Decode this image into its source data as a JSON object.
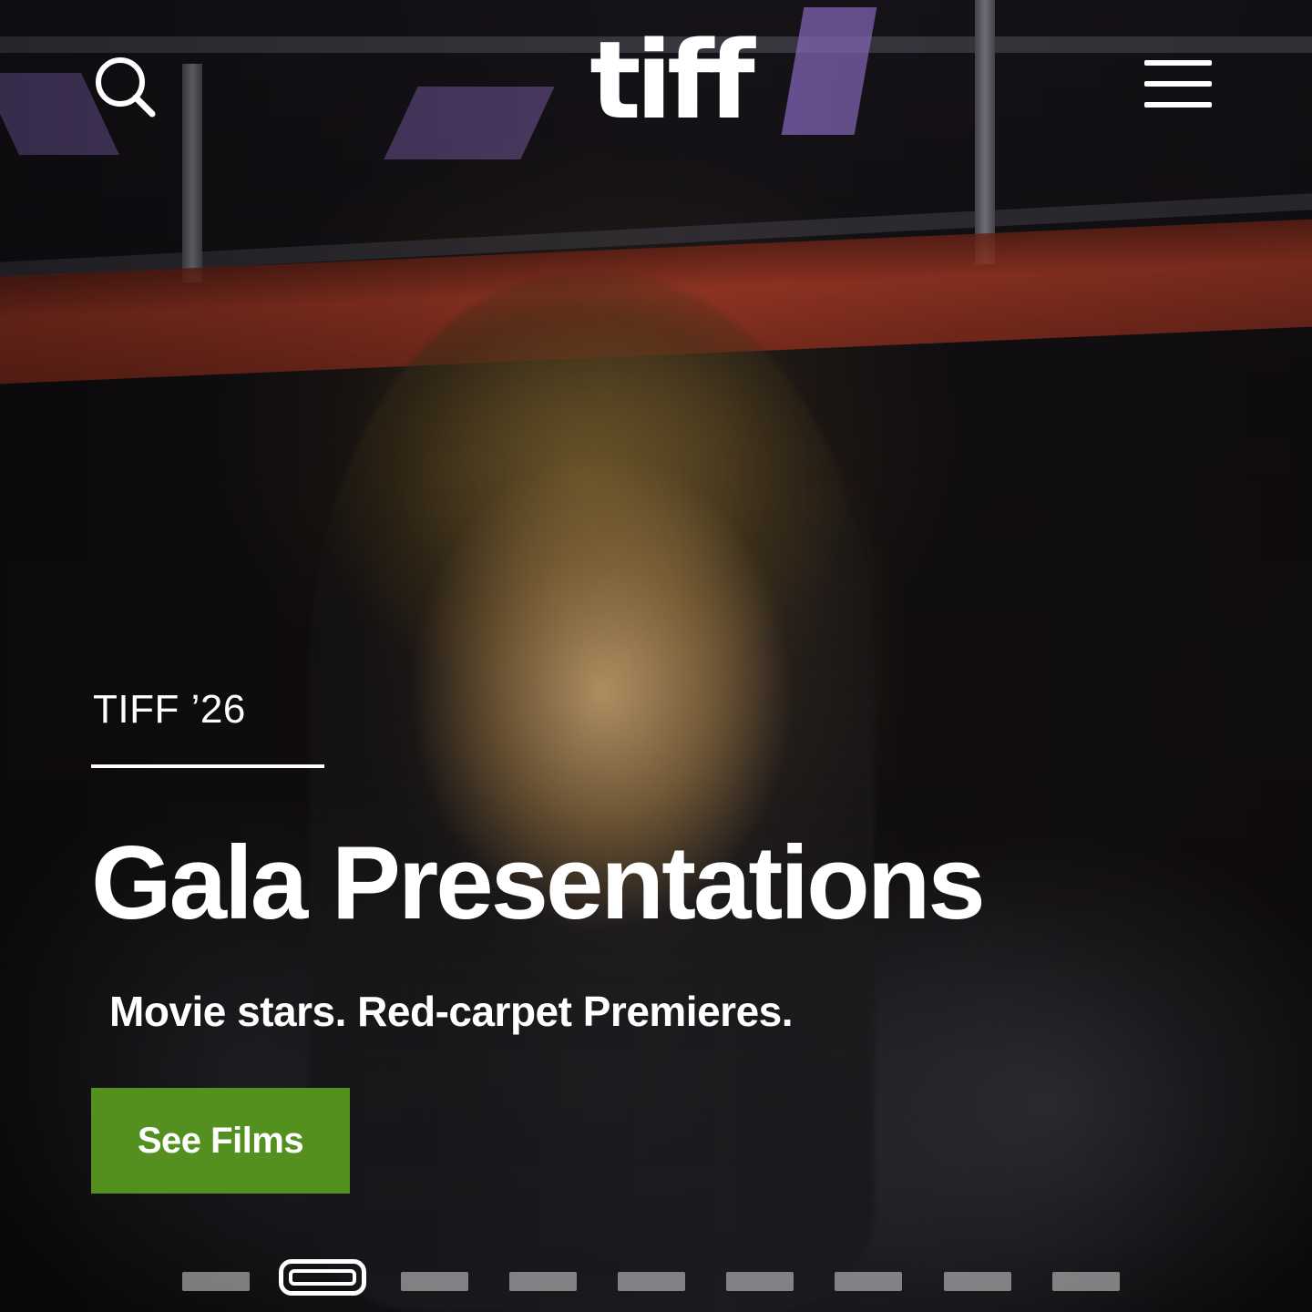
{
  "header": {
    "logo_text": "tiff",
    "search_icon": "search-icon",
    "menu_icon": "hamburger-menu-icon"
  },
  "hero": {
    "eyebrow": "TIFF ’26",
    "title": "Gala Presentations",
    "subtitle": "Movie stars. Red-carpet Premieres.",
    "cta_label": "See Films",
    "cta_color": "#53901f"
  },
  "carousel": {
    "slide_count": 9,
    "active_index": 1
  }
}
